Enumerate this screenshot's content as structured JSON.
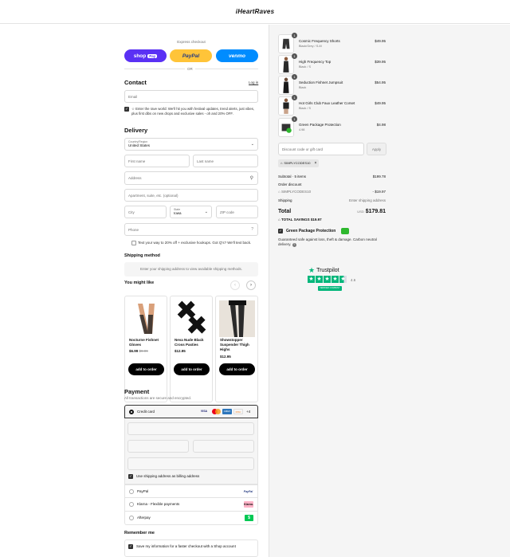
{
  "header": {
    "logo": "iHeartRaves"
  },
  "express": {
    "label": "Express checkout",
    "shop_label": "shop",
    "shop_pay": "Pay",
    "paypal_label": "PayPal",
    "venmo_label": "venmo",
    "or_label": "OR"
  },
  "contact": {
    "title": "Contact",
    "login_label": "Log in",
    "email_placeholder": "Email",
    "optin_text": "Enter the rave world: We'll hit you with festival updates, trend alerts, just vibes, plus first dibs on new drops and exclusive sales - oh and 20% OFF.",
    "optin_prefix": "☆"
  },
  "delivery": {
    "title": "Delivery",
    "country_label": "Country/Region",
    "country_value": "United States",
    "first_name": "First name",
    "last_name": "Last name",
    "address": "Address",
    "apartment": "Apartment, suite, etc. (optional)",
    "city": "City",
    "state_label": "State",
    "state_value": "Iowa",
    "zip": "ZIP code",
    "phone": "Phone",
    "sms_text": "Text your way to 20% off + exclusive hookups. Got Q's? We'll text back."
  },
  "shipping_method": {
    "title": "Shipping method",
    "note": "Enter your shipping address to view available shipping methods."
  },
  "upsell": {
    "title": "You might like",
    "products": [
      {
        "name": "Nocturne Fishnet Gloves",
        "price": "$6.99",
        "compare": "$9.99",
        "button": "add to order"
      },
      {
        "name": "Neva Nude Black Cross Pasties",
        "price": "$12.95",
        "compare": "",
        "button": "add to order"
      },
      {
        "name": "Showstopper Suspender Thigh Highs",
        "price": "$12.95",
        "compare": "",
        "button": "add to order"
      }
    ]
  },
  "payment": {
    "title": "Payment",
    "subtitle": "All transactions are secure and encrypted.",
    "credit_card": "Credit card",
    "card_brands": [
      "VISA",
      "MC",
      "AMEX",
      "DISC"
    ],
    "more_label": "+4",
    "billing_same": "Use shipping address as billing address",
    "options": [
      {
        "label": "PayPal",
        "logo": "PayPal"
      },
      {
        "label": "Klarna - Flexible payments",
        "logo": "Klarna."
      },
      {
        "label": "Afterpay",
        "logo": "$"
      }
    ]
  },
  "remember": {
    "title": "Remember me",
    "save_text": "Save my information for a faster checkout with a Shop account"
  },
  "cart": {
    "items": [
      {
        "qty": "1",
        "name": "Cosmic Frequency Shorts",
        "variant": "Black/Grey / S-M",
        "price": "$49.95"
      },
      {
        "qty": "1",
        "name": "High Frequency Top",
        "variant": "Black / S",
        "price": "$39.95"
      },
      {
        "qty": "1",
        "name": "Seduction Fishnet Jumpsuit",
        "variant": "Black",
        "price": "$54.95"
      },
      {
        "qty": "1",
        "name": "Hot Girls Club Faux Leather Corset",
        "variant": "Black / S",
        "price": "$49.95"
      },
      {
        "qty": "1",
        "name": "Green Package Protection",
        "variant": "4.98",
        "price": "$4.98"
      }
    ],
    "discount_placeholder": "Discount code or gift card",
    "apply_label": "Apply",
    "code_tag": "SIMPLYCODES10",
    "subtotal_label": "Subtotal · 5 items",
    "subtotal_value": "$199.78",
    "order_discount_label": "Order discount",
    "discount_code": "SIMPLYCODES10",
    "discount_value": "- $19.97",
    "shipping_label": "Shipping",
    "shipping_value": "Enter shipping address",
    "total_label": "Total",
    "currency": "USD",
    "total_value": "$179.81",
    "savings_label": "TOTAL SAVINGS",
    "savings_value": "$19.97",
    "protection_label": "Green Package Protection",
    "protection_text": "Guaranteed safe against loss, theft & damage. Carbon neutral delivery.",
    "trustpilot_label": "Trustpilot",
    "trust_score": "4.6",
    "trust_badge": "VERIFIED COMPANY"
  },
  "colors": {
    "shop": "#5a31f4",
    "paypal": "#ffc439",
    "venmo": "#008cff",
    "trustpilot": "#00b67a"
  }
}
